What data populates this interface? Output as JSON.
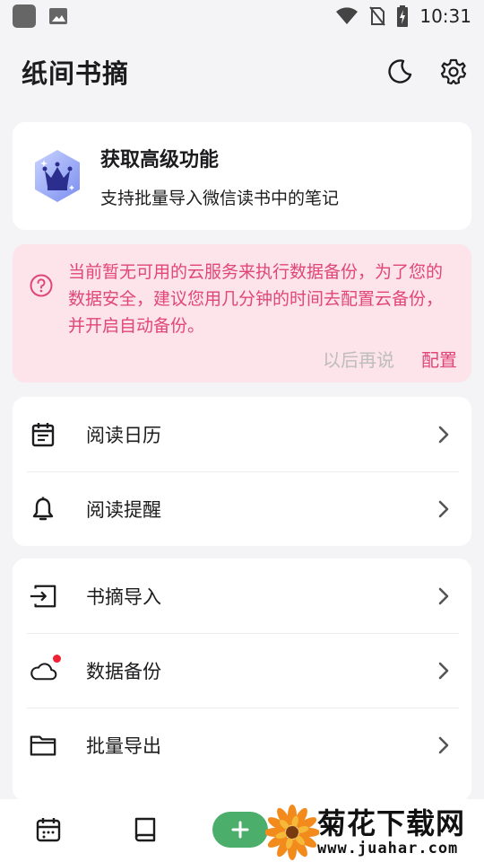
{
  "status_bar": {
    "time": "10:31"
  },
  "app": {
    "title": "纸间书摘"
  },
  "premium": {
    "title": "获取高级功能",
    "subtitle": "支持批量导入微信读书中的笔记"
  },
  "alert": {
    "message": "当前暂无可用的云服务来执行数据备份，为了您的数据安全，建议您用几分钟的时间去配置云备份，并开启自动备份。",
    "later_label": "以后再说",
    "config_label": "配置"
  },
  "menu_group_1": {
    "items": [
      {
        "label": "阅读日历",
        "icon": "calendar-icon"
      },
      {
        "label": "阅读提醒",
        "icon": "bell-icon"
      }
    ]
  },
  "menu_group_2": {
    "items": [
      {
        "label": "书摘导入",
        "icon": "import-icon"
      },
      {
        "label": "数据备份",
        "icon": "cloud-icon"
      },
      {
        "label": "批量导出",
        "icon": "folder-icon"
      }
    ]
  },
  "watermark": {
    "brand": "菊花下载网",
    "url": "www.juahar.com"
  },
  "colors": {
    "accent_pink": "#e0467a",
    "alert_bg": "#fde3ea",
    "fab_green": "#4cae6b",
    "badge_red": "#ee2233"
  }
}
